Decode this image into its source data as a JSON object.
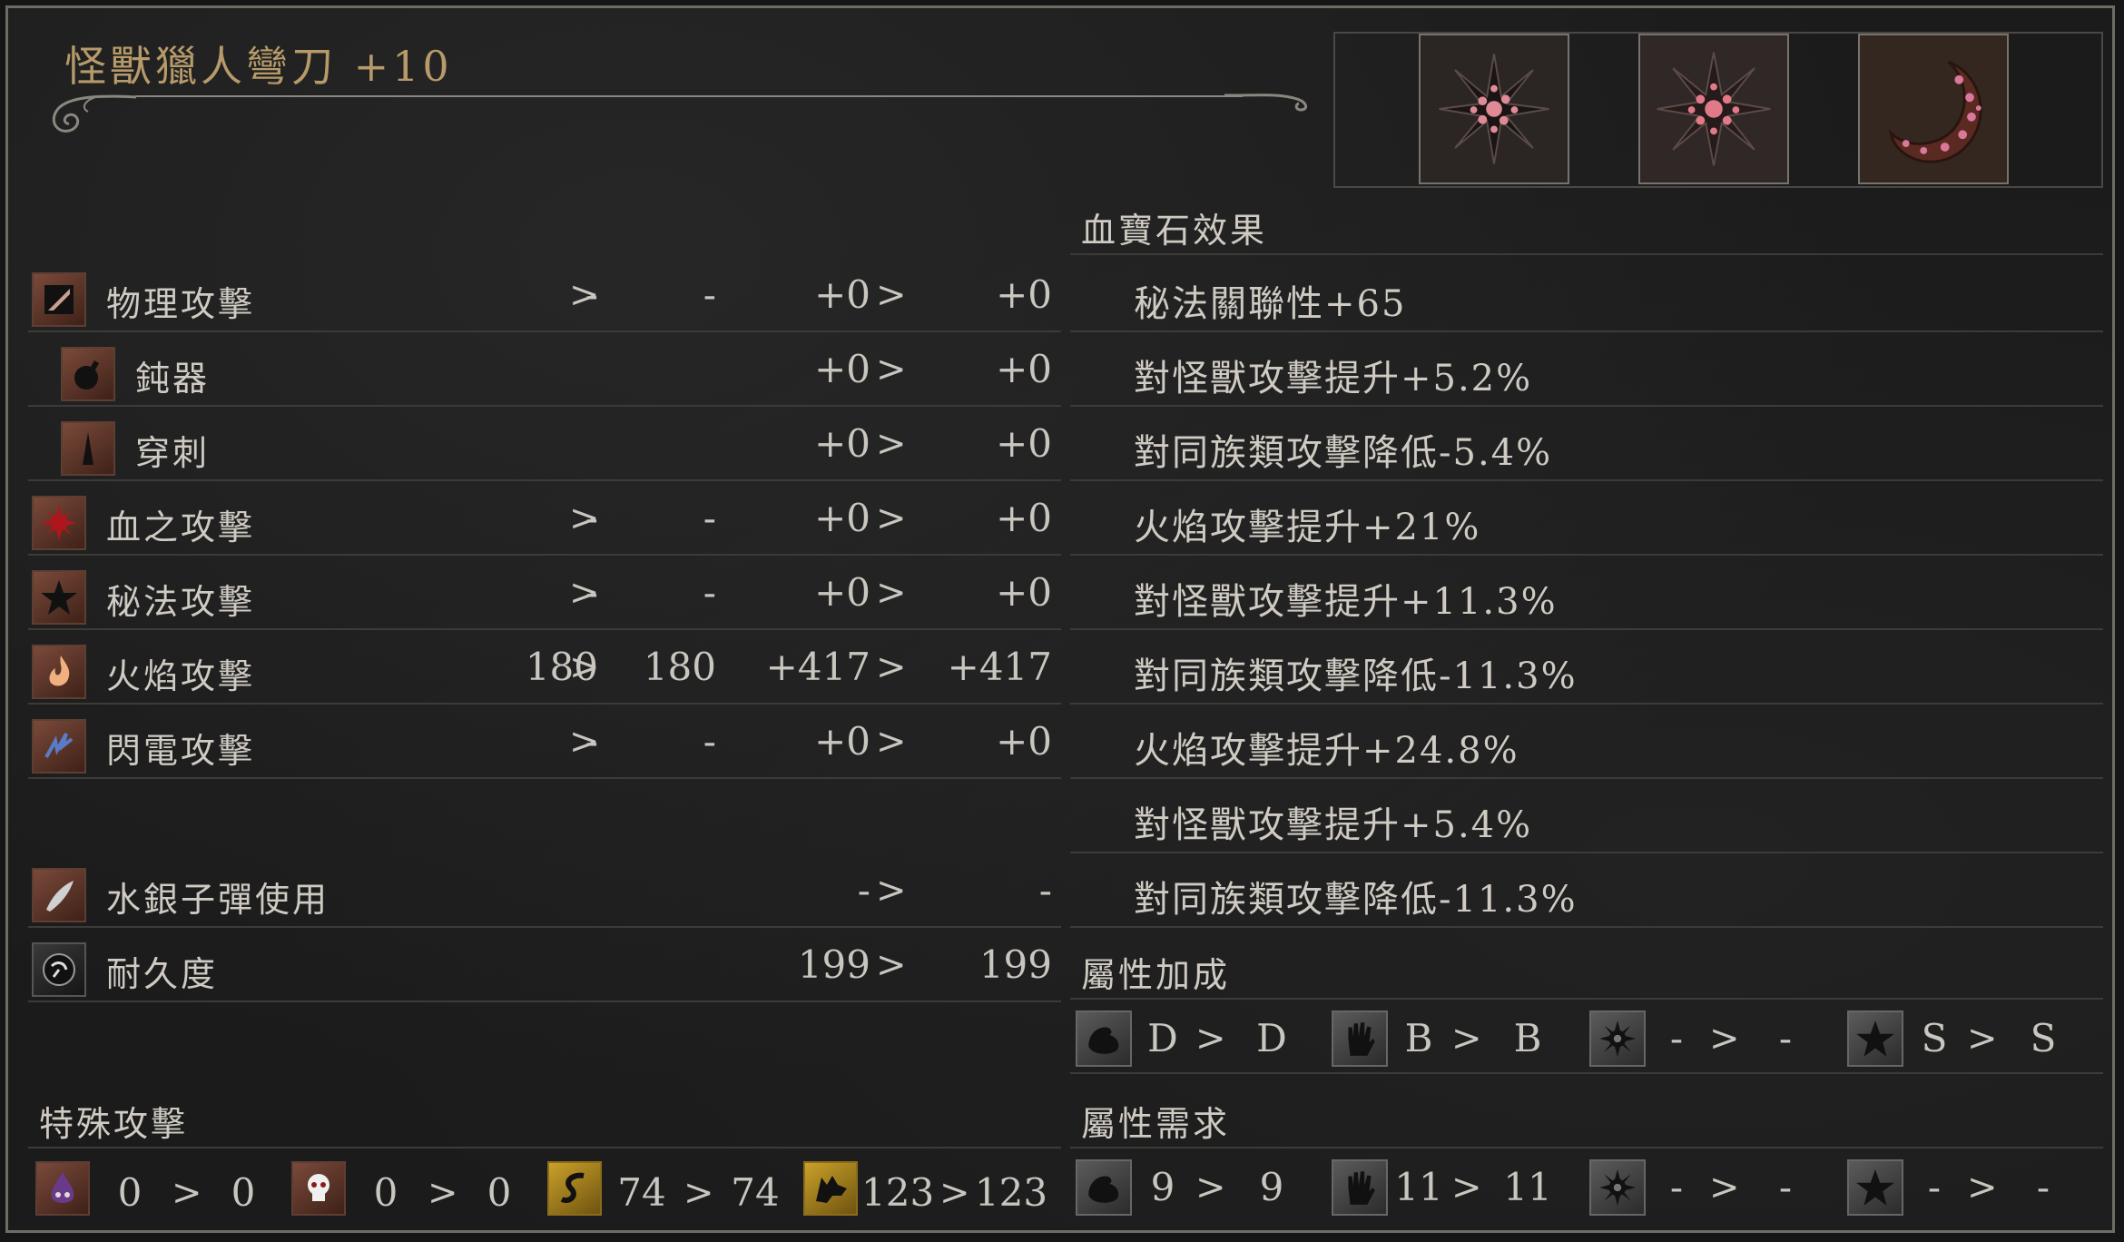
{
  "weapon": {
    "name": "怪獸獵人彎刀 +10"
  },
  "gems": [
    {
      "icon": "radial-blood-gem-icon"
    },
    {
      "icon": "radial-blood-gem-icon"
    },
    {
      "icon": "waning-blood-gem-icon"
    }
  ],
  "attack_rows": [
    {
      "label": "物理攻擊",
      "icon": "physical-attack-icon",
      "a": "-",
      "b": "-",
      "c": "+0",
      "d": "+0"
    },
    {
      "label": "鈍器",
      "icon": "blunt-icon",
      "a": "",
      "b": "",
      "c": "+0",
      "d": "+0"
    },
    {
      "label": "穿刺",
      "icon": "thrust-icon",
      "a": "",
      "b": "",
      "c": "+0",
      "d": "+0"
    },
    {
      "label": "血之攻擊",
      "icon": "blood-attack-icon",
      "a": "-",
      "b": "-",
      "c": "+0",
      "d": "+0"
    },
    {
      "label": "秘法攻擊",
      "icon": "arcane-attack-icon",
      "a": "-",
      "b": "-",
      "c": "+0",
      "d": "+0"
    },
    {
      "label": "火焰攻擊",
      "icon": "fire-attack-icon",
      "a": "180",
      "b": "180",
      "c": "+417",
      "d": "+417"
    },
    {
      "label": "閃電攻擊",
      "icon": "bolt-attack-icon",
      "a": "-",
      "b": "-",
      "c": "+0",
      "d": "+0"
    }
  ],
  "quicksilver": {
    "label": "水銀子彈使用",
    "icon": "quicksilver-bullet-icon",
    "a": "-",
    "b": "-"
  },
  "durability": {
    "label": "耐久度",
    "icon": "durability-icon",
    "a": "199",
    "b": "199"
  },
  "special_attack": {
    "title": "特殊攻擊",
    "items": [
      {
        "icon": "kin-icon",
        "a": "0",
        "b": "0"
      },
      {
        "icon": "skull-icon",
        "a": "0",
        "b": "0"
      },
      {
        "icon": "serpent-icon",
        "a": "74",
        "b": "74"
      },
      {
        "icon": "beast-icon",
        "a": "123",
        "b": "123"
      }
    ]
  },
  "gem_effects": {
    "title": "血寶石效果",
    "lines": [
      "秘法關聯性+65",
      "對怪獸攻擊提升+5.2%",
      "對同族類攻擊降低-5.4%",
      "火焰攻擊提升+21%",
      "對怪獸攻擊提升+11.3%",
      "對同族類攻擊降低-11.3%",
      "火焰攻擊提升+24.8%",
      "對怪獸攻擊提升+5.4%",
      "對同族類攻擊降低-11.3%"
    ]
  },
  "scaling": {
    "title": "屬性加成",
    "items": [
      {
        "icon": "strength-icon",
        "a": "D",
        "b": "D"
      },
      {
        "icon": "skill-icon",
        "a": "B",
        "b": "B"
      },
      {
        "icon": "bloodtinge-icon",
        "a": "-",
        "b": "-"
      },
      {
        "icon": "arcane-icon",
        "a": "S",
        "b": "S"
      }
    ]
  },
  "requirements": {
    "title": "屬性需求",
    "items": [
      {
        "icon": "strength-icon",
        "a": "9",
        "b": "9"
      },
      {
        "icon": "skill-icon",
        "a": "11",
        "b": "11"
      },
      {
        "icon": "bloodtinge-icon",
        "a": "-",
        "b": "-"
      },
      {
        "icon": "arcane-icon",
        "a": "-",
        "b": "-"
      }
    ]
  },
  "arrow_symbol": ">",
  "colors": {
    "title_gold": "#b69a6a",
    "background": "#1b1b1b",
    "text": "#cfcbc3"
  }
}
